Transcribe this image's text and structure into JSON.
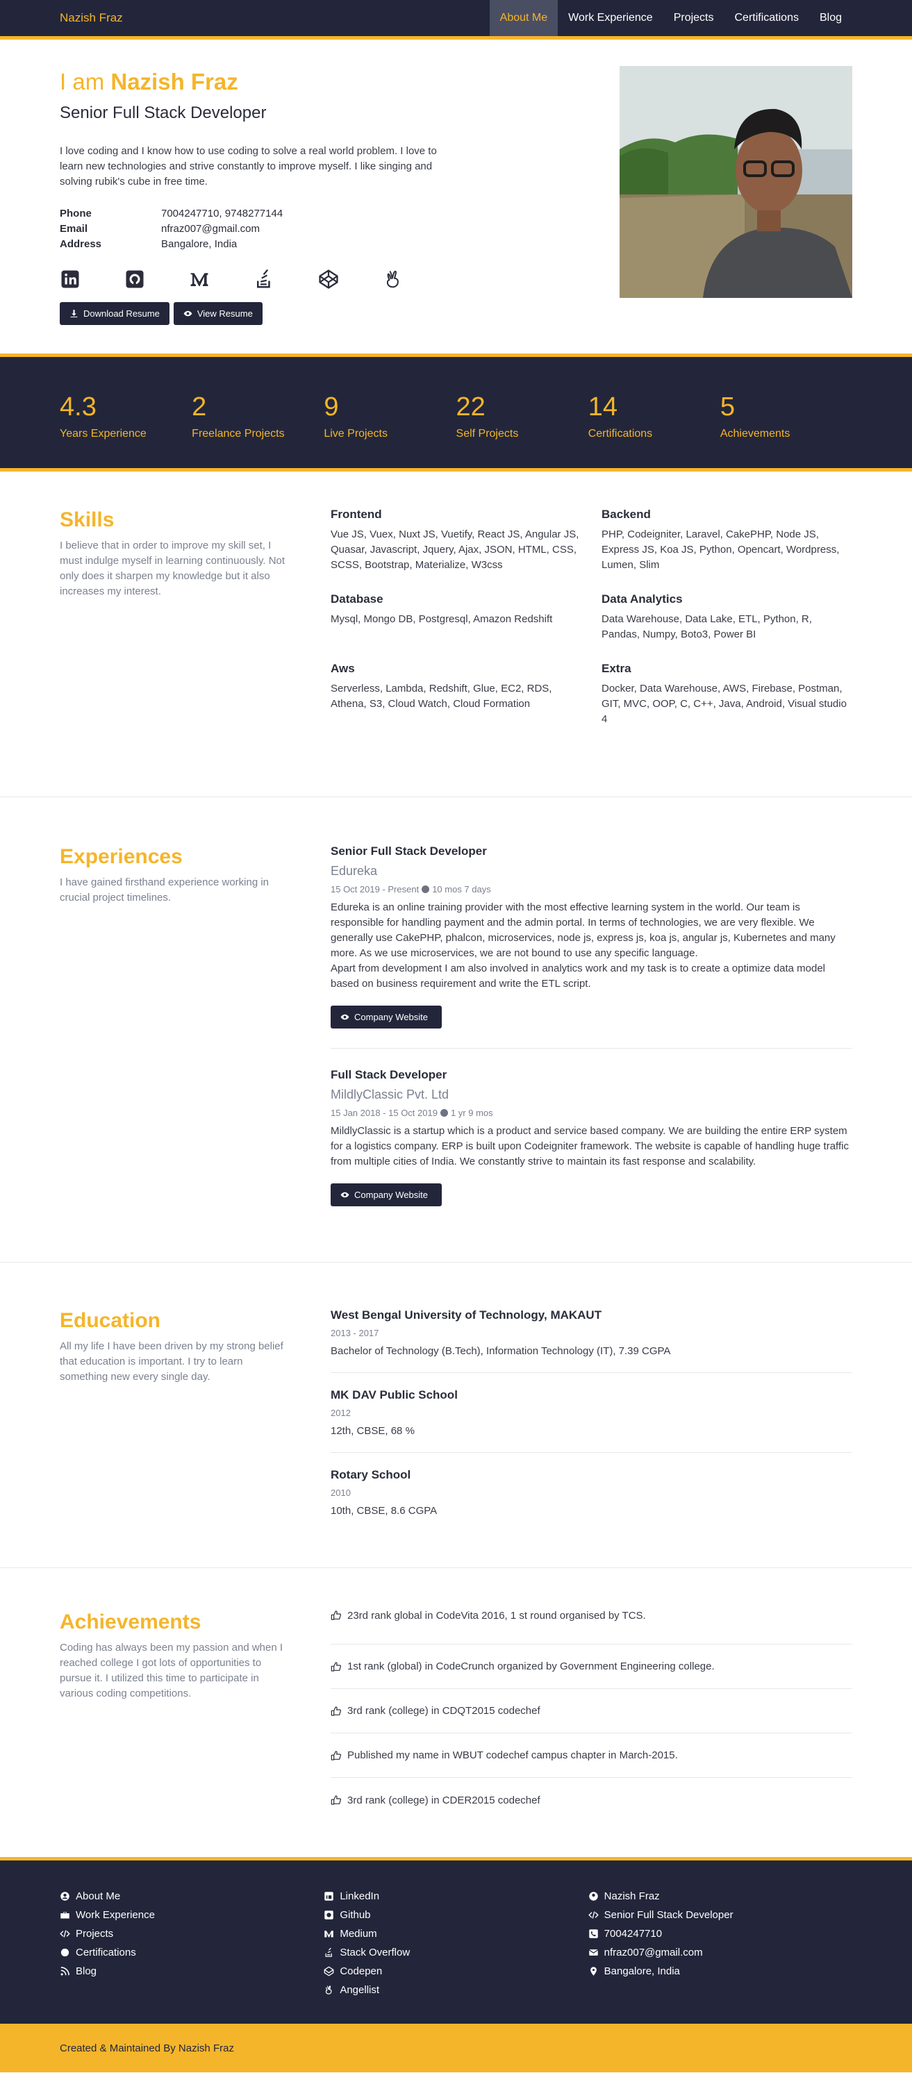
{
  "nav": {
    "brand": "Nazish Fraz",
    "links": [
      "About Me",
      "Work Experience",
      "Projects",
      "Certifications",
      "Blog"
    ]
  },
  "hero": {
    "greeting": "I am",
    "name": "Nazish Fraz",
    "title": "Senior Full Stack Developer",
    "bio": "I love coding and I know how to use coding to solve a real world problem. I love to learn new technologies and strive constantly to improve myself. I like singing and solving rubik's cube in free time.",
    "contact": [
      {
        "label": "Phone",
        "value": "7004247710, 9748277144"
      },
      {
        "label": "Email",
        "value": "nfraz007@gmail.com"
      },
      {
        "label": "Address",
        "value": "Bangalore, India"
      }
    ],
    "socials": [
      "linkedin-icon",
      "github-icon",
      "medium-icon",
      "stackoverflow-icon",
      "codepen-icon",
      "angellist-icon"
    ],
    "download_label": "Download Resume",
    "view_label": "View Resume"
  },
  "stats": [
    {
      "num": "4.3",
      "label": "Years Experience"
    },
    {
      "num": "2",
      "label": "Freelance Projects"
    },
    {
      "num": "9",
      "label": "Live Projects"
    },
    {
      "num": "22",
      "label": "Self Projects"
    },
    {
      "num": "14",
      "label": "Certifications"
    },
    {
      "num": "5",
      "label": "Achievements"
    }
  ],
  "skills": {
    "title": "Skills",
    "desc": "I believe that in order to improve my skill set, I must indulge myself in learning continuously. Not only does it sharpen my knowledge but it also increases my interest.",
    "items": [
      {
        "name": "Frontend",
        "list": "Vue JS, Vuex, Nuxt JS, Vuetify, React JS, Angular JS, Quasar, Javascript, Jquery, Ajax, JSON, HTML, CSS, SCSS, Bootstrap, Materialize, W3css"
      },
      {
        "name": "Backend",
        "list": "PHP, Codeigniter, Laravel, CakePHP, Node JS, Express JS, Koa JS, Python, Opencart, Wordpress, Lumen, Slim"
      },
      {
        "name": "Database",
        "list": "Mysql, Mongo DB, Postgresql, Amazon Redshift"
      },
      {
        "name": "Data Analytics",
        "list": "Data Warehouse, Data Lake, ETL, Python, R, Pandas, Numpy, Boto3, Power BI"
      },
      {
        "name": "Aws",
        "list": "Serverless, Lambda, Redshift, Glue, EC2, RDS, Athena, S3, Cloud Watch, Cloud Formation"
      },
      {
        "name": "Extra",
        "list": "Docker, Data Warehouse, AWS, Firebase, Postman, GIT, MVC, OOP, C, C++, Java, Android, Visual studio 4"
      }
    ]
  },
  "experiences": {
    "title": "Experiences",
    "desc": "I have gained firsthand experience working in crucial project timelines.",
    "items": [
      {
        "role": "Senior Full Stack Developer",
        "company": "Edureka",
        "period": "15 Oct 2019 - Present",
        "duration": "10 mos 7 days",
        "desc": "Edureka is an online training provider with the most effective learning system in the world. Our team is responsible for handling payment and the admin portal. In terms of technologies, we are very flexible. We generally use CakePHP, phalcon, microservices, node js, express js, koa js, angular js, Kubernetes and many more. As we use microservices, we are not bound to use any specific language.",
        "desc2": "Apart from development I am also involved in analytics work and my task is to create a optimize data model based on business requirement and write the ETL script.",
        "button": "Company Website"
      },
      {
        "role": "Full Stack Developer",
        "company": "MildlyClassic Pvt. Ltd",
        "period": "15 Jan 2018 - 15 Oct 2019",
        "duration": "1 yr 9 mos",
        "desc": "MildlyClassic is a startup which is a product and service based company. We are building the entire ERP system for a logistics company. ERP is built upon Codeigniter framework. The website is capable of handling huge traffic from multiple cities of India. We constantly strive to maintain its fast response and scalability.",
        "desc2": "",
        "button": "Company Website"
      }
    ]
  },
  "education": {
    "title": "Education",
    "desc": "All my life I have been driven by my strong belief that education is important. I try to learn something new every single day.",
    "items": [
      {
        "school": "West Bengal University of Technology, MAKAUT",
        "year": "2013 - 2017",
        "degree": "Bachelor of Technology (B.Tech), Information Technology (IT), 7.39 CGPA"
      },
      {
        "school": "MK DAV Public School",
        "year": "2012",
        "degree": "12th, CBSE, 68 %"
      },
      {
        "school": "Rotary School",
        "year": "2010",
        "degree": "10th, CBSE, 8.6 CGPA"
      }
    ]
  },
  "achievements": {
    "title": "Achievements",
    "desc": "Coding has always been my passion and when I reached college I got lots of opportunities to pursue it. I utilized this time to participate in various coding competitions.",
    "items": [
      "23rd rank global in CodeVita 2016, 1 st round organised by TCS.",
      "1st rank (global) in CodeCrunch organized by Government Engineering college.",
      "3rd rank (college) in CDQT2015 codechef",
      "Published my name in WBUT codechef campus chapter in March-2015.",
      "3rd rank (college) in CDER2015 codechef"
    ]
  },
  "footer": {
    "col1": [
      "About Me",
      "Work Experience",
      "Projects",
      "Certifications",
      "Blog"
    ],
    "col2": [
      "LinkedIn",
      "Github",
      "Medium",
      "Stack Overflow",
      "Codepen",
      "Angellist"
    ],
    "col3": [
      "Nazish Fraz",
      "Senior Full Stack Developer",
      "7004247710",
      "nfraz007@gmail.com",
      "Bangalore, India"
    ],
    "credit": "Created & Maintained By Nazish Fraz"
  },
  "colors": {
    "accent": "#f5b52a",
    "dark": "#23263a"
  }
}
